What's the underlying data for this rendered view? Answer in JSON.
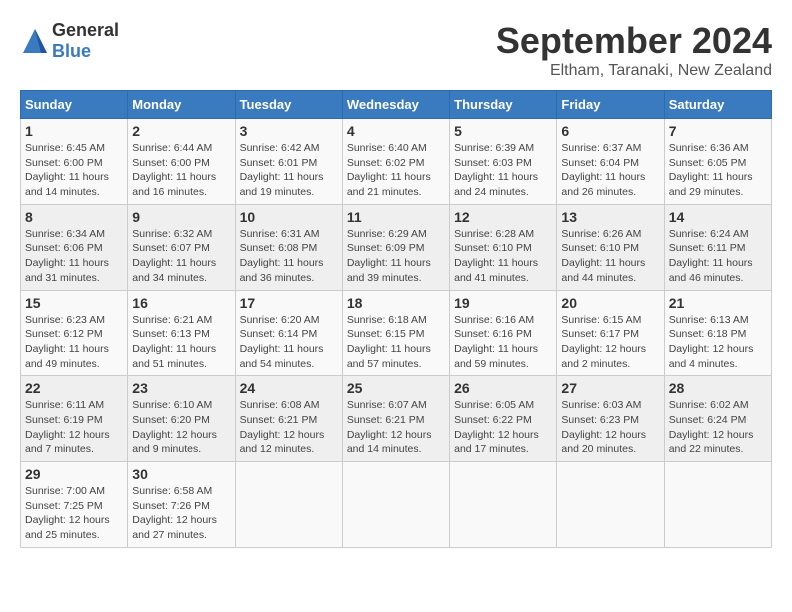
{
  "header": {
    "logo_general": "General",
    "logo_blue": "Blue",
    "month_title": "September 2024",
    "location": "Eltham, Taranaki, New Zealand"
  },
  "days_of_week": [
    "Sunday",
    "Monday",
    "Tuesday",
    "Wednesday",
    "Thursday",
    "Friday",
    "Saturday"
  ],
  "weeks": [
    [
      {
        "num": "1",
        "info": "Sunrise: 6:45 AM\nSunset: 6:00 PM\nDaylight: 11 hours\nand 14 minutes."
      },
      {
        "num": "2",
        "info": "Sunrise: 6:44 AM\nSunset: 6:00 PM\nDaylight: 11 hours\nand 16 minutes."
      },
      {
        "num": "3",
        "info": "Sunrise: 6:42 AM\nSunset: 6:01 PM\nDaylight: 11 hours\nand 19 minutes."
      },
      {
        "num": "4",
        "info": "Sunrise: 6:40 AM\nSunset: 6:02 PM\nDaylight: 11 hours\nand 21 minutes."
      },
      {
        "num": "5",
        "info": "Sunrise: 6:39 AM\nSunset: 6:03 PM\nDaylight: 11 hours\nand 24 minutes."
      },
      {
        "num": "6",
        "info": "Sunrise: 6:37 AM\nSunset: 6:04 PM\nDaylight: 11 hours\nand 26 minutes."
      },
      {
        "num": "7",
        "info": "Sunrise: 6:36 AM\nSunset: 6:05 PM\nDaylight: 11 hours\nand 29 minutes."
      }
    ],
    [
      {
        "num": "8",
        "info": "Sunrise: 6:34 AM\nSunset: 6:06 PM\nDaylight: 11 hours\nand 31 minutes."
      },
      {
        "num": "9",
        "info": "Sunrise: 6:32 AM\nSunset: 6:07 PM\nDaylight: 11 hours\nand 34 minutes."
      },
      {
        "num": "10",
        "info": "Sunrise: 6:31 AM\nSunset: 6:08 PM\nDaylight: 11 hours\nand 36 minutes."
      },
      {
        "num": "11",
        "info": "Sunrise: 6:29 AM\nSunset: 6:09 PM\nDaylight: 11 hours\nand 39 minutes."
      },
      {
        "num": "12",
        "info": "Sunrise: 6:28 AM\nSunset: 6:10 PM\nDaylight: 11 hours\nand 41 minutes."
      },
      {
        "num": "13",
        "info": "Sunrise: 6:26 AM\nSunset: 6:10 PM\nDaylight: 11 hours\nand 44 minutes."
      },
      {
        "num": "14",
        "info": "Sunrise: 6:24 AM\nSunset: 6:11 PM\nDaylight: 11 hours\nand 46 minutes."
      }
    ],
    [
      {
        "num": "15",
        "info": "Sunrise: 6:23 AM\nSunset: 6:12 PM\nDaylight: 11 hours\nand 49 minutes."
      },
      {
        "num": "16",
        "info": "Sunrise: 6:21 AM\nSunset: 6:13 PM\nDaylight: 11 hours\nand 51 minutes."
      },
      {
        "num": "17",
        "info": "Sunrise: 6:20 AM\nSunset: 6:14 PM\nDaylight: 11 hours\nand 54 minutes."
      },
      {
        "num": "18",
        "info": "Sunrise: 6:18 AM\nSunset: 6:15 PM\nDaylight: 11 hours\nand 57 minutes."
      },
      {
        "num": "19",
        "info": "Sunrise: 6:16 AM\nSunset: 6:16 PM\nDaylight: 11 hours\nand 59 minutes."
      },
      {
        "num": "20",
        "info": "Sunrise: 6:15 AM\nSunset: 6:17 PM\nDaylight: 12 hours\nand 2 minutes."
      },
      {
        "num": "21",
        "info": "Sunrise: 6:13 AM\nSunset: 6:18 PM\nDaylight: 12 hours\nand 4 minutes."
      }
    ],
    [
      {
        "num": "22",
        "info": "Sunrise: 6:11 AM\nSunset: 6:19 PM\nDaylight: 12 hours\nand 7 minutes."
      },
      {
        "num": "23",
        "info": "Sunrise: 6:10 AM\nSunset: 6:20 PM\nDaylight: 12 hours\nand 9 minutes."
      },
      {
        "num": "24",
        "info": "Sunrise: 6:08 AM\nSunset: 6:21 PM\nDaylight: 12 hours\nand 12 minutes."
      },
      {
        "num": "25",
        "info": "Sunrise: 6:07 AM\nSunset: 6:21 PM\nDaylight: 12 hours\nand 14 minutes."
      },
      {
        "num": "26",
        "info": "Sunrise: 6:05 AM\nSunset: 6:22 PM\nDaylight: 12 hours\nand 17 minutes."
      },
      {
        "num": "27",
        "info": "Sunrise: 6:03 AM\nSunset: 6:23 PM\nDaylight: 12 hours\nand 20 minutes."
      },
      {
        "num": "28",
        "info": "Sunrise: 6:02 AM\nSunset: 6:24 PM\nDaylight: 12 hours\nand 22 minutes."
      }
    ],
    [
      {
        "num": "29",
        "info": "Sunrise: 7:00 AM\nSunset: 7:25 PM\nDaylight: 12 hours\nand 25 minutes."
      },
      {
        "num": "30",
        "info": "Sunrise: 6:58 AM\nSunset: 7:26 PM\nDaylight: 12 hours\nand 27 minutes."
      },
      null,
      null,
      null,
      null,
      null
    ]
  ]
}
